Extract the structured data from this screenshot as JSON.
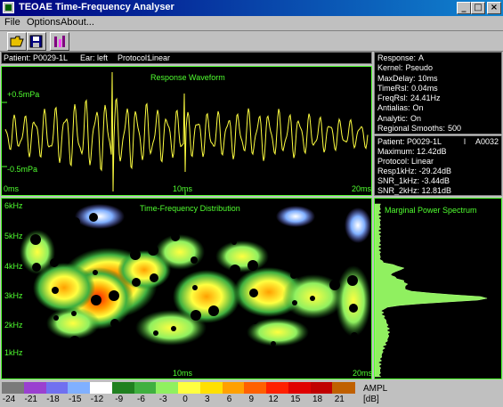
{
  "window": {
    "title": "TEOAE Time-Frequency Analyser"
  },
  "menu": [
    "File",
    "Options",
    "About..."
  ],
  "info_bar": {
    "patient_label": "Patient:",
    "patient": "P0029-1L",
    "ear_label": "Ear:",
    "ear": "left",
    "protocol_label": "Protocol:",
    "protocol": "Linear"
  },
  "waveform": {
    "title": "Response Waveform",
    "y_top": "+0.5mPa",
    "y_bottom": "-0.5mPa",
    "x_left": "0ms",
    "x_mid": "10ms",
    "x_right": "20ms",
    "color": "#ffff40"
  },
  "settings": [
    {
      "label": "Response:",
      "value": "A"
    },
    {
      "label": "Kernel:",
      "value": "Pseudo"
    },
    {
      "label": "MaxDelay:",
      "value": "10ms"
    },
    {
      "label": "TimeRsl:",
      "value": "0.04ms"
    },
    {
      "label": "FreqRsl:",
      "value": "24.41Hz"
    },
    {
      "label": "Antialias:",
      "value": "On"
    },
    {
      "label": "Analytic:",
      "value": "On"
    },
    {
      "label": "Regional Smooths:",
      "value": "500"
    }
  ],
  "results": {
    "patient_line": "Patient: P0029-1L",
    "ear_code": "l",
    "record": "A0032",
    "lines": [
      "Maximum: 12.42dB",
      "Protocol: Linear",
      "Resp1kHz: -29.24dB",
      "SNR_1kHz: -3.44dB",
      "SNR_2kHz: 12.81dB"
    ]
  },
  "tfd": {
    "title": "Time-Frequency Distribution",
    "y_labels": [
      "6kHz",
      "5kHz",
      "4kHz",
      "3kHz",
      "2kHz",
      "1kHz"
    ],
    "x_mid": "10ms",
    "x_right": "20ms"
  },
  "marginal": {
    "title": "Marginal Power Spectrum"
  },
  "legend": {
    "unit_top": "AMPL",
    "unit_bottom": "[dB]",
    "ticks": [
      "-24",
      "-21",
      "-18",
      "-15",
      "-12",
      "-9",
      "-6",
      "-3",
      "0",
      "3",
      "6",
      "9",
      "12",
      "15",
      "18",
      "21"
    ],
    "colors": [
      "#7a7a7a",
      "#9a40d0",
      "#7070f0",
      "#80b0ff",
      "#ffffff",
      "#208020",
      "#40b040",
      "#90f060",
      "#ffff40",
      "#ffe000",
      "#ffa000",
      "#ff6000",
      "#ff2000",
      "#e00000",
      "#c00000",
      "#c06000"
    ]
  }
}
